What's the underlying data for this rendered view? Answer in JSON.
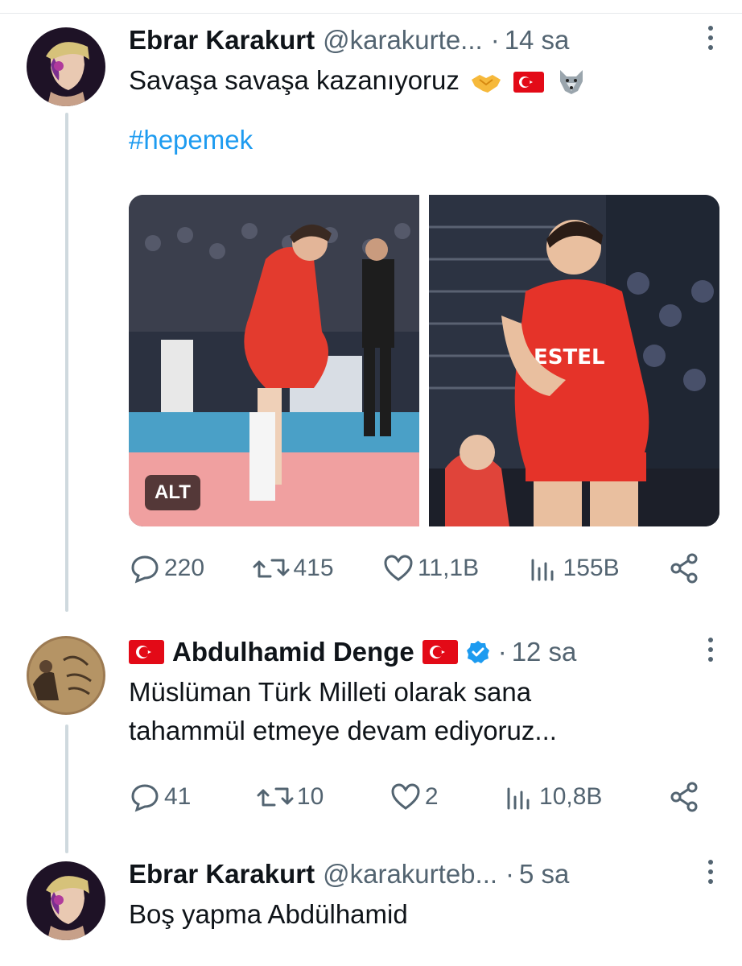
{
  "colors": {
    "link": "#1d9bf0",
    "secondary": "#536471",
    "thread": "#cfd9de",
    "flag_red": "#e30a17"
  },
  "tweets": [
    {
      "name": "Ebrar Karakurt",
      "handle": "@karakurte...",
      "separator": "·",
      "time": "14 sa",
      "text": "Savaşa savaşa kazanıyoruz",
      "emojis": [
        "handshake-emoji",
        "turkish-flag-emoji",
        "wolf-emoji"
      ],
      "hashtag": "#hepemek",
      "media_alt_label": "ALT",
      "stats": {
        "replies": "220",
        "retweets": "415",
        "likes": "11,1B",
        "views": "155B"
      }
    },
    {
      "name": "Abdulhamid Denge",
      "separator": "·",
      "time": "12 sa",
      "text_line1": "Müslüman Türk Milleti olarak sana",
      "text_line2": "tahammül etmeye devam ediyoruz...",
      "stats": {
        "replies": "41",
        "retweets": "10",
        "likes": "2",
        "views": "10,8B"
      }
    },
    {
      "name": "Ebrar Karakurt",
      "handle": "@karakurteb...",
      "separator": "·",
      "time": "5 sa",
      "text": "Boş yapma Abdülhamid"
    }
  ]
}
